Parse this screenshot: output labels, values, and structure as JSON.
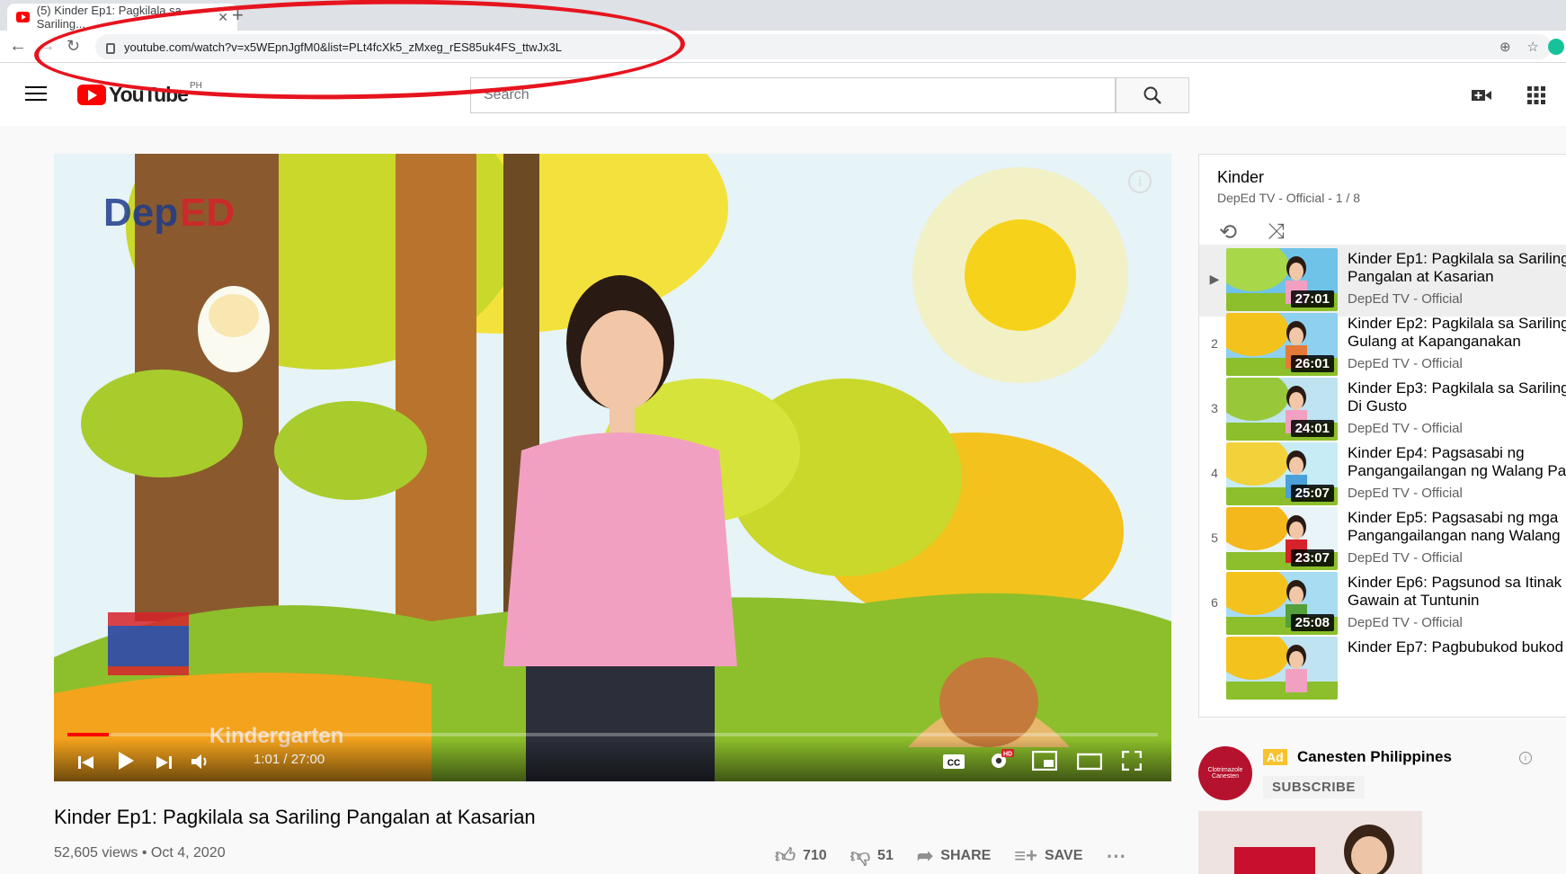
{
  "browser": {
    "tab_title": "(5) Kinder Ep1: Pagkilala sa Sariling...",
    "url": "youtube.com/watch?v=x5WEpnJgfM0&list=PLt4fcXk5_zMxeg_rES85uk4FS_ttwJx3L"
  },
  "header": {
    "logo_text": "YouTube",
    "country_code": "PH",
    "search_placeholder": "Search"
  },
  "player": {
    "overlay_label": "Kindergarten",
    "current_time": "1:01",
    "duration": "27:00",
    "time_display": "1:01 / 27:00",
    "progress_fraction": 0.038,
    "hd_badge": "HD",
    "scene_colors": {
      "sky": "#e8f4f8",
      "sun": "#f7d21a",
      "grass": "#8cbf2b",
      "tree_yellow": "#f4c21c",
      "shirt": "#f2a0c2"
    }
  },
  "video": {
    "title": "Kinder Ep1: Pagkilala sa Sariling Pangalan at Kasarian",
    "meta": "52,605 views • Oct 4, 2020",
    "likes": "710",
    "dislikes": "51",
    "share_label": "SHARE",
    "save_label": "SAVE"
  },
  "playlist": {
    "title": "Kinder",
    "subtitle": "DepEd TV - Official - 1 / 8",
    "items": [
      {
        "index": "▶",
        "title": "Kinder Ep1: Pagkilala sa Sariling Pangalan at Kasarian",
        "channel": "DepEd TV - Official",
        "duration": "27:01"
      },
      {
        "index": "2",
        "title": "Kinder Ep2: Pagkilala sa Sariling Gulang at Kapanganakan",
        "channel": "DepEd TV - Official",
        "duration": "26:01"
      },
      {
        "index": "3",
        "title": "Kinder Ep3: Pagkilala sa Sariling Di Gusto",
        "channel": "DepEd TV - Official",
        "duration": "24:01"
      },
      {
        "index": "4",
        "title": "Kinder Ep4: Pagsasabi ng Pangangailangan ng Walang Pa",
        "channel": "DepEd TV - Official",
        "duration": "25:07"
      },
      {
        "index": "5",
        "title": "Kinder Ep5: Pagsasabi ng mga Pangangailangan nang Walang",
        "channel": "DepEd TV - Official",
        "duration": "23:07"
      },
      {
        "index": "6",
        "title": "Kinder Ep6: Pagsunod sa Itinak Gawain at Tuntunin",
        "channel": "DepEd TV - Official",
        "duration": "25:08"
      },
      {
        "index": "",
        "title": "Kinder Ep7: Pagbubukod bukod",
        "channel": "",
        "duration": ""
      }
    ]
  },
  "ad": {
    "badge": "Ad",
    "advertiser": "Canesten Philippines",
    "subscribe_label": "SUBSCRIBE",
    "logo_text": "Clotrimazole Canesten"
  },
  "icons": [
    "back-icon",
    "forward-icon",
    "reload-icon",
    "lock-icon",
    "zoom-icon",
    "star-icon",
    "menu-icon",
    "search-icon",
    "create-video-icon",
    "apps-icon",
    "info-icon",
    "prev-icon",
    "play-icon",
    "next-icon",
    "volume-icon",
    "cc-icon",
    "settings-icon",
    "miniplayer-icon",
    "theater-icon",
    "fullscreen-icon",
    "like-icon",
    "dislike-icon",
    "share-icon",
    "save-icon",
    "more-icon",
    "loop-icon",
    "shuffle-icon"
  ]
}
